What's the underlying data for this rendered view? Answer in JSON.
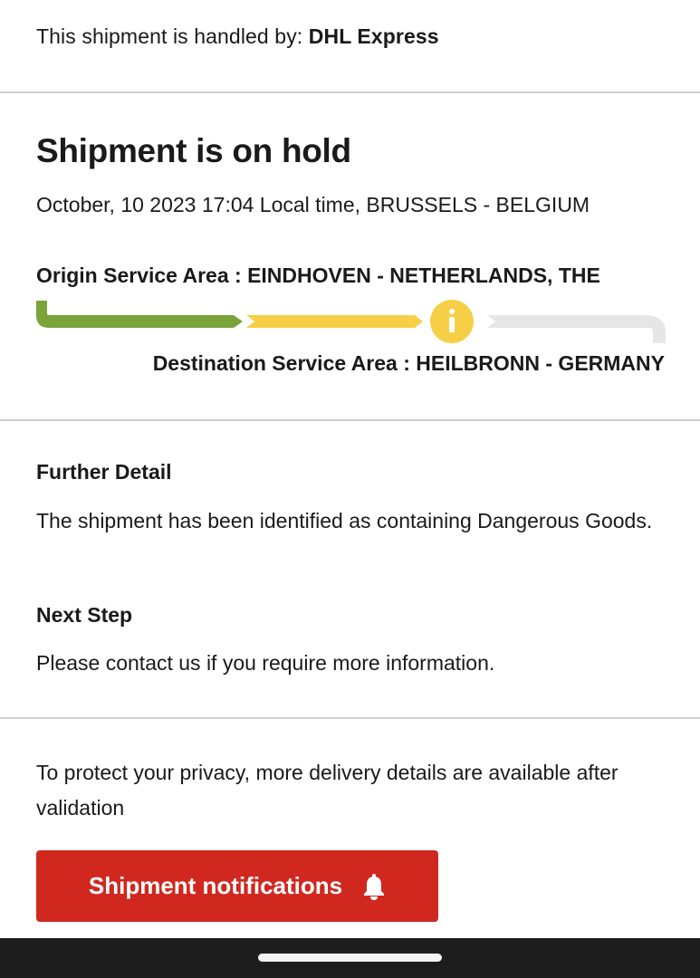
{
  "handler": {
    "prefix": "This shipment is handled by: ",
    "carrier": "DHL Express"
  },
  "status": {
    "title": "Shipment is on hold",
    "date_location": "October, 10 2023 17:04 Local time, BRUSSELS - BELGIUM",
    "origin": "Origin Service Area : EINDHOVEN - NETHERLANDS, THE",
    "destination": "Destination Service Area : HEILBRONN - GERMANY",
    "progress_colors": {
      "complete": "#7aa33a",
      "in_progress": "#f7cf46",
      "pending": "#e6e6e6",
      "info_badge": "#f7cf46"
    },
    "info_icon": "info-icon"
  },
  "details": {
    "further_heading": "Further Detail",
    "further_text": "The shipment has been identified as containing Dangerous Goods.",
    "next_heading": "Next Step",
    "next_text": "Please contact us if you require more information."
  },
  "privacy": {
    "text": "To protect your privacy, more delivery details are available after validation",
    "button_label": "Shipment notifications",
    "button_icon": "bell-icon",
    "button_color": "#d0281f"
  }
}
